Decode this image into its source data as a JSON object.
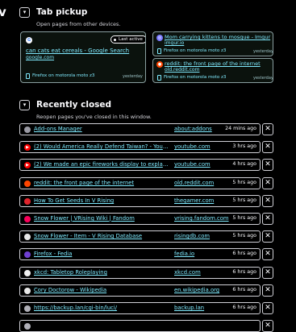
{
  "edge_text": "v",
  "tab_pickup": {
    "toggle": "▾",
    "title": "Tab pickup",
    "subtitle": "Open pages from other devices.",
    "cards": [
      {
        "title": "can cats eat cereals - Google Search",
        "url": "google.com",
        "badge": "Last active",
        "device": "Firefox on motorola moto z3",
        "time": "yesterday",
        "favicon": "google-icon",
        "favicon_color": "#fbfbfe"
      },
      {
        "title": "Mom carrying kittens to mosque - Imgur",
        "url": "imgur.io",
        "device": "Firefox on motorola moto z3",
        "time": "yesterday",
        "favicon": "globe-icon",
        "favicon_color": "#7a7aff"
      },
      {
        "title": "reddit: the front page of the internet",
        "url": "old.reddit.com",
        "device": "Firefox on motorola moto z3",
        "time": "yesterday",
        "favicon": "reddit-icon",
        "favicon_color": "#ff4500"
      }
    ]
  },
  "recently_closed": {
    "toggle": "▾",
    "title": "Recently closed",
    "subtitle": "Reopen pages you've closed in this window.",
    "dismiss_glyph": "✕",
    "rows": [
      {
        "title": "Add-ons Manager",
        "url": "about:addons",
        "time": "24 mins ago",
        "favicon": "puzzle-icon",
        "color": "#9a9aa4",
        "glyph": ""
      },
      {
        "title": "(2) Would America Really Defend Taiwan? - YouTube",
        "url": "youtube.com",
        "time": "3 hrs ago",
        "favicon": "youtube-icon",
        "color": "#ff0000",
        "glyph": "▶"
      },
      {
        "title": "(2) We made an epic fireworks display to explain...",
        "url": "youtube.com",
        "time": "4 hrs ago",
        "favicon": "youtube-icon",
        "color": "#ff0000",
        "glyph": "▶"
      },
      {
        "title": "reddit: the front page of the internet",
        "url": "old.reddit.com",
        "time": "5 hrs ago",
        "favicon": "reddit-icon",
        "color": "#ff4500",
        "glyph": ""
      },
      {
        "title": "How To Get Seeds In V Rising",
        "url": "thegamer.com",
        "time": "5 hrs ago",
        "favicon": "thegamer-icon",
        "color": "#e0242c",
        "glyph": ""
      },
      {
        "title": "Snow Flower | VRising Wiki | Fandom",
        "url": "vrising.fandom.com",
        "time": "5 hrs ago",
        "favicon": "fandom-icon",
        "color": "#fa005a",
        "glyph": ""
      },
      {
        "title": "Snow Flower - Item - V Rising Database",
        "url": "risingdb.com",
        "time": "5 hrs ago",
        "favicon": "risingdb-icon",
        "color": "#e8e8e8",
        "glyph": ""
      },
      {
        "title": "Firefox - Fedia",
        "url": "fedia.io",
        "time": "6 hrs ago",
        "favicon": "fedia-icon",
        "color": "#6f3fd1",
        "glyph": ""
      },
      {
        "title": "xkcd: Tabletop Roleplaying",
        "url": "xkcd.com",
        "time": "6 hrs ago",
        "favicon": "xkcd-icon",
        "color": "#f0f0f0",
        "glyph": ""
      },
      {
        "title": "Cory Doctorow - Wikipedia",
        "url": "en.wikipedia.org",
        "time": "6 hrs ago",
        "favicon": "wikipedia-icon",
        "color": "#e8e8e8",
        "glyph": ""
      },
      {
        "title": "https://backup.lan/cgi-bin/luci/",
        "url": "backup.lan",
        "time": "6 hrs ago",
        "favicon": "globe-icon",
        "color": "#b0b0b8",
        "glyph": ""
      },
      {
        "title": "",
        "url": "",
        "time": "",
        "favicon": "globe-icon",
        "color": "#b0b0b8",
        "glyph": ""
      }
    ]
  }
}
